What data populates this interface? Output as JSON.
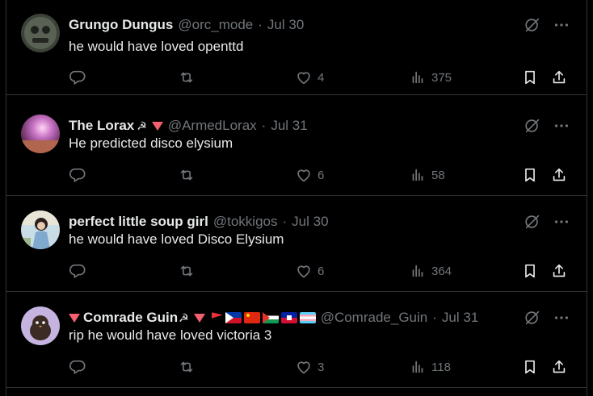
{
  "tweets": [
    {
      "name": "Grungo Dungus",
      "handle": "@orc_mode",
      "date": "Jul 30",
      "text": "he would have loved openttd",
      "likes": "4",
      "views": "375"
    },
    {
      "name": "The Lorax",
      "name_glyph": "☭",
      "handle": "@ArmedLorax",
      "date": "Jul 31",
      "text": "He predicted disco elysium",
      "likes": "6",
      "views": "58"
    },
    {
      "name": "perfect little soup girl",
      "handle": "@tokkigos",
      "date": "Jul 30",
      "text": "he would have loved Disco Elysium",
      "likes": "6",
      "views": "364"
    },
    {
      "name": "Comrade Guin",
      "name_glyph": "☭",
      "handle": "@Comrade_Guin",
      "date": "Jul 31",
      "text": "rip he would have loved victoria 3",
      "likes": "3",
      "views": "118"
    }
  ],
  "separator": "·",
  "colors": {
    "background": "#000000",
    "text": "#e7e9ea",
    "muted": "#71767b",
    "border": "#2f3336",
    "red_triangle": "#f4606f"
  },
  "icons": [
    "reply-icon",
    "retweet-icon",
    "like-icon",
    "views-icon",
    "bookmark-icon",
    "share-icon",
    "grok-icon",
    "more-icon"
  ]
}
